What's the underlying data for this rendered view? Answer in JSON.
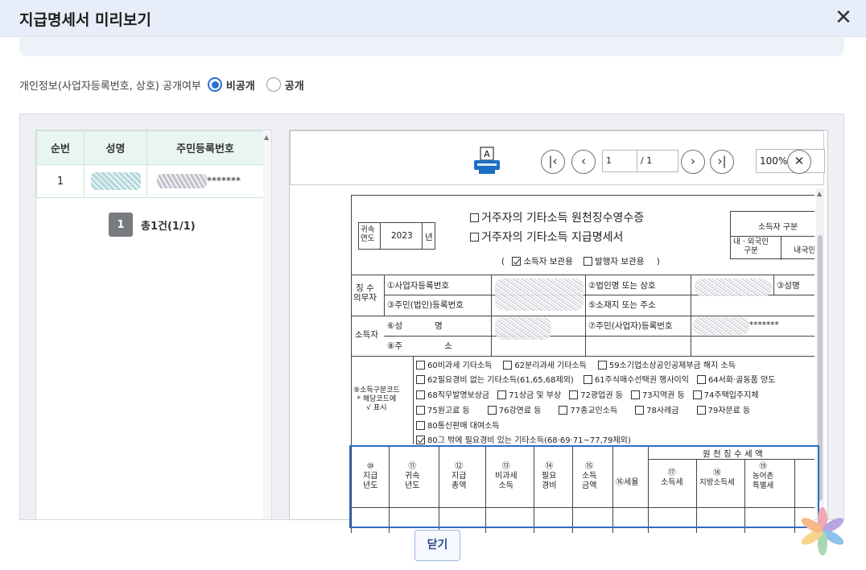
{
  "dialog": {
    "title": "지급명세서 미리보기",
    "close_icon": "close-icon"
  },
  "privacy": {
    "label": "개인정보(사업자등록번호, 상호) 공개여부",
    "options": [
      {
        "label": "비공개",
        "selected": true
      },
      {
        "label": "공개",
        "selected": false
      }
    ]
  },
  "list": {
    "headers": [
      "순번",
      "성명",
      "주민등록번호"
    ],
    "rows": [
      {
        "no": "1",
        "name": "",
        "rrn": "*******"
      }
    ],
    "page_number": "1",
    "summary": "총1건(1/1)"
  },
  "viewer": {
    "print_icon": "print-icon",
    "page_input": "1",
    "page_total": "/ 1",
    "zoom": "100%",
    "buttons": [
      "first-page",
      "prev-page",
      "next-page",
      "last-page",
      "zoom-close"
    ]
  },
  "document": {
    "heading1": "거주자의 기타소득 원천징수영수증",
    "heading2": "거주자의 기타소득 지급명세서",
    "year_label": "귀속\n연도",
    "year_value": "2023",
    "year_suffix": "년",
    "copy_label_open": "(",
    "copy_label_close": ")",
    "copy_options": [
      "소득자 보관용",
      "발행자 보관용"
    ],
    "resident_box": "소득자 구분",
    "resident_sub": "내 · 외국인\n구분",
    "resident_value": "내국인",
    "payer_label": "징 수\n의무자",
    "payer_rows": [
      "①사업자등록번호",
      "③주민(법인)등록번호"
    ],
    "payer_right": [
      "②법인명 또는 상호",
      "⑤소재지 또는 주소"
    ],
    "payer_extra": "③성명",
    "earner_label": "소득자",
    "earner_rows": [
      "⑥성",
      "명",
      "⑧주",
      "소"
    ],
    "earner_right": "⑦주민(사업자)등록번호",
    "earner_rrn_suffix": "*******",
    "code_label": "⑨소득구분코드\n* 해당코드에\n√ 표시",
    "codes": [
      [
        "60비과세 기타소득",
        "62분리과세 기타소득",
        "59소기업소상공인공제부금 해지 소득"
      ],
      [
        "62필요경비 없는 기타소득(61,65,68제외)",
        "61주식매수선택권 행사이익",
        "64서화·골동품 양도"
      ],
      [
        "68직무발명보상금",
        "71상금 및 부상",
        "72광업권 등",
        "73지역권 등",
        "74주택입주지체"
      ],
      [
        "75원고료 등",
        "76강연료 등",
        "77종교인소득",
        "78사례금",
        "79자문료 등"
      ],
      [
        "80통신판매 대여소득"
      ],
      [
        "80그 밖에 필요경비 있는 기타소득(68·69·71~77,79제외)"
      ]
    ],
    "checked_code": 5,
    "tax_group": "원 천 징 수 세 액",
    "columns": [
      "⑩\n지급\n년도",
      "⑪\n귀속\n년도",
      "⑫\n지급\n총액",
      "⑬\n비과세\n소득",
      "⑭\n필요\n경비",
      "⑮\n소득\n금액",
      "⑯세율",
      "⑰\n소득세",
      "⑱\n지방소득세",
      "⑲\n농어촌\n특별세"
    ]
  },
  "footer": {
    "close_label": "닫기"
  }
}
